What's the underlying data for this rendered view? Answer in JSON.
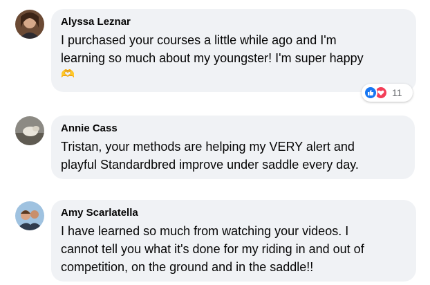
{
  "comments": [
    {
      "author": "Alyssa Leznar",
      "line1": "I purchased your courses a little while ago and I'm",
      "line2": "learning so much about my youngster! I'm super happy",
      "emoji": "🫶",
      "reaction_count": "11",
      "reactions": [
        "like-icon",
        "love-icon"
      ]
    },
    {
      "author": "Annie Cass",
      "line1": "Tristan, your methods are helping my VERY alert and",
      "line2": "playful Standardbred improve under saddle every day."
    },
    {
      "author": "Amy Scarlatella",
      "line1": "I have learned so much from watching your videos. I",
      "line2": "cannot tell you what it's done for my riding in and out of",
      "line3": "competition, on the ground and in the saddle!!"
    }
  ],
  "colors": {
    "bubble": "#f0f2f5",
    "text": "#050505",
    "like": "#1877f2",
    "love": "#f33e58",
    "count": "#65676b"
  }
}
